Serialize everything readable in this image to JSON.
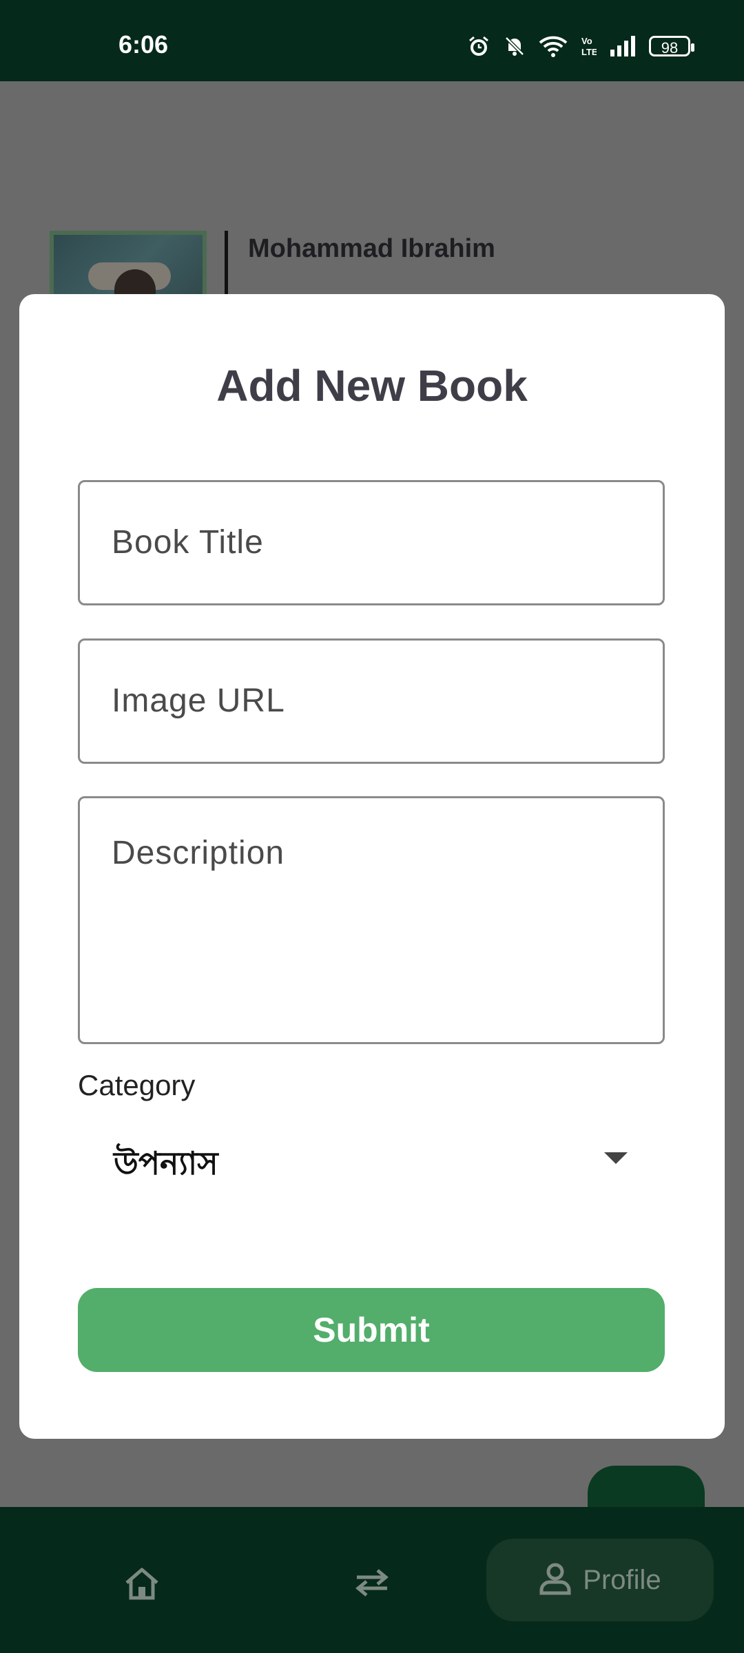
{
  "status_bar": {
    "time": "6:06",
    "battery": "98",
    "icons": [
      "alarm-icon",
      "bell-off-icon",
      "wifi-icon",
      "volte-icon",
      "signal-icon",
      "battery-icon"
    ]
  },
  "background": {
    "profile_name": "Mohammad Ibrahim"
  },
  "modal": {
    "title": "Add New Book",
    "book_title_placeholder": "Book Title",
    "image_url_placeholder": "Image URL",
    "description_placeholder": "Description",
    "category_label": "Category",
    "category_value": "উপন্যাস",
    "submit_label": "Submit"
  },
  "bottom_nav": {
    "items": [
      {
        "icon": "home-icon"
      },
      {
        "icon": "swap-icon"
      },
      {
        "icon": "person-icon",
        "label": "Profile"
      }
    ]
  },
  "colors": {
    "status_bar": "#05291a",
    "overlay": "#6a6a6a",
    "accent_green": "#52ae6a",
    "nav_active": "#173826"
  }
}
